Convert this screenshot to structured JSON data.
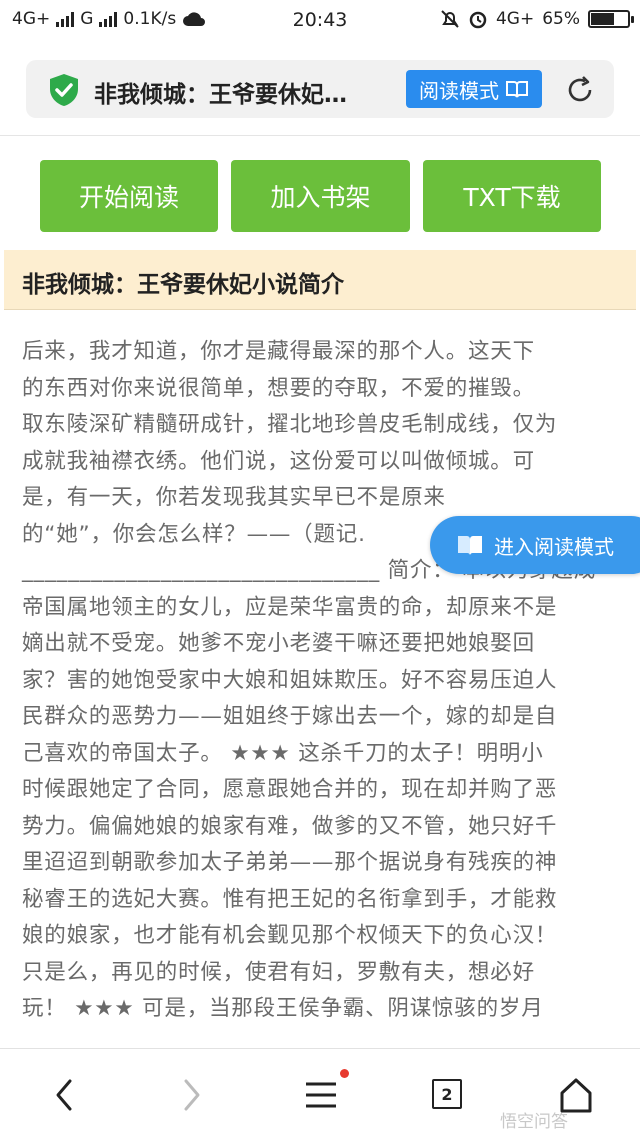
{
  "status_bar": {
    "network_left": "4G+",
    "network_g": "G",
    "speed": "0.1K/s",
    "time": "20:43",
    "network_right": "4G+",
    "battery": "65%"
  },
  "address_bar": {
    "title": "非我倾城：王爷要休妃…",
    "read_mode_label": "阅读模式",
    "icons": [
      "shield-check-icon",
      "book-icon",
      "refresh-icon"
    ]
  },
  "actions": {
    "start_reading": "开始阅读",
    "add_to_shelf": "加入书架",
    "txt_download": "TXT下载"
  },
  "intro": {
    "heading": "非我倾城：王爷要休妃小说简介",
    "lines": [
      "后来，我才知道，你才是藏得最深的那个人。这天下",
      "的东西对你来说很简单，想要的夺取，不爱的摧毁。",
      "取东陵深矿精髓研成针，擢北地珍兽皮毛制成线，仅为",
      "成就我袖襟衣绣。他们说，这份爱可以叫做倾城。可",
      "是，有一天，你若发现我其实早已不是原来",
      "的“她”，你会怎么样？——（题记.",
      "_______________________________ 简介：  本以为穿越成",
      "帝国属地领主的女儿，应是荣华富贵的命，却原来不是",
      "嫡出就不受宠。她爹不宠小老婆干嘛还要把她娘娶回",
      "家？害的她饱受家中大娘和姐妹欺压。好不容易压迫人",
      "民群众的恶势力——姐姐终于嫁出去一个，嫁的却是自",
      "己喜欢的帝国太子。 ★★★ 这杀千刀的太子！明明小",
      "时候跟她定了合同，愿意跟她合并的，现在却并购了恶",
      "势力。偏偏她娘的娘家有难，做爹的又不管，她只好千",
      "里迢迢到朝歌参加太子弟弟——那个据说身有残疾的神",
      "秘睿王的选妃大赛。惟有把王妃的名衔拿到手，才能救",
      "娘的娘家，也才能有机会觐见那个权倾天下的负心汉！",
      "只是么，再见的时候，使君有妇，罗敷有夫，想必好",
      "玩！ ★★★ 可是，当那段王侯争霸、阴谋惊骇的岁月"
    ]
  },
  "floating_button": {
    "label": "进入阅读模式"
  },
  "bottom_nav": {
    "tab_count": "2",
    "watermark": "悟空问答",
    "icons": [
      "back-icon",
      "forward-icon",
      "menu-icon",
      "tabs-icon",
      "home-icon"
    ]
  }
}
